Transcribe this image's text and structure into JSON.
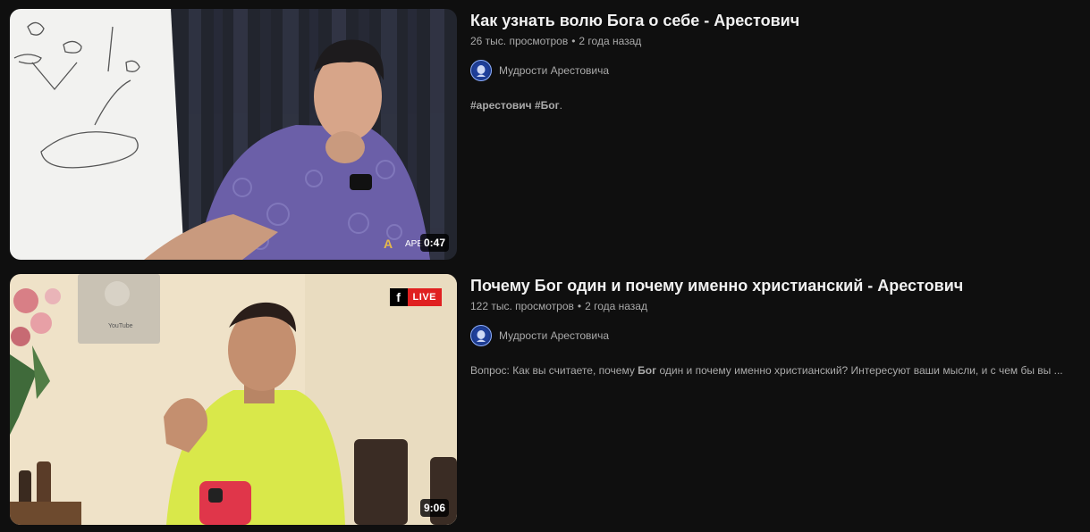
{
  "videos": [
    {
      "title": "Как узнать волю Бога о себе - Арестович",
      "views": "26 тыс. просмотров",
      "age": "2 года назад",
      "channel": "Мудрости Арестовича",
      "duration": "0:47",
      "description_parts": [
        "#арестович",
        " ",
        "#Бог",
        "."
      ],
      "watermark": "АРЕ"
    },
    {
      "title": "Почему Бог один и почему именно христианский - Арестович",
      "views": "122 тыс. просмотров",
      "age": "2 года назад",
      "channel": "Мудрости Арестовича",
      "duration": "9:06",
      "description_before": "Вопрос: Как вы считаете, почему ",
      "description_bold": "Бог",
      "description_after": " один и почему именно христианский? Интересуют ваши мысли, и с чем бы вы ...",
      "live_badge": {
        "fb_icon": "f",
        "label": "LIVE"
      },
      "plaque_text": "YouTube"
    }
  ],
  "separator": "•",
  "colors": {
    "background": "#0f0f0f",
    "title": "#f1f1f1",
    "secondary": "#aaaaaa",
    "live": "#e02020"
  }
}
